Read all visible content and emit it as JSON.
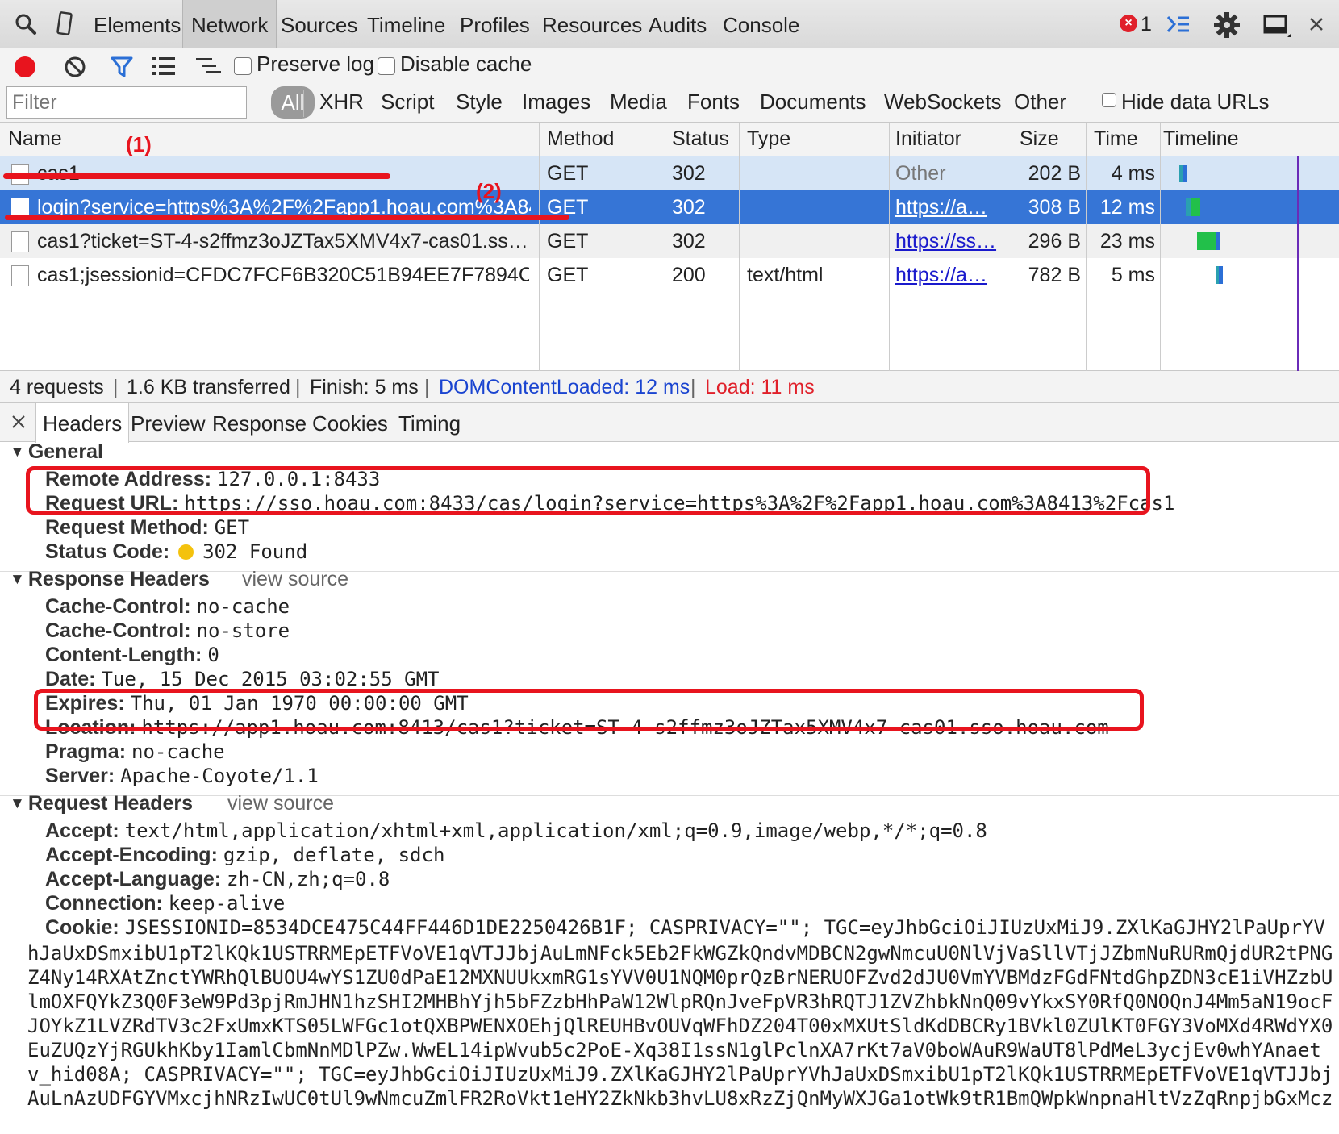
{
  "topbar": {
    "tabs": [
      "Elements",
      "Network",
      "Sources",
      "Timeline",
      "Profiles",
      "Resources",
      "Audits",
      "Console"
    ],
    "active_tab": "Network",
    "error_count": "1"
  },
  "toolbar": {
    "preserve_log": "Preserve log",
    "disable_cache": "Disable cache"
  },
  "filter": {
    "placeholder": "Filter",
    "types": [
      "All",
      "XHR",
      "Script",
      "Style",
      "Images",
      "Media",
      "Fonts",
      "Documents",
      "WebSockets",
      "Other"
    ],
    "hide_data_urls": "Hide data URLs"
  },
  "table": {
    "columns": [
      "Name",
      "Method",
      "Status",
      "Type",
      "Initiator",
      "Size",
      "Time",
      "Timeline"
    ],
    "rows": [
      {
        "name": "cas1",
        "method": "GET",
        "status": "302",
        "type": "",
        "initiator": "Other",
        "size": "202 B",
        "time": "4 ms"
      },
      {
        "name": "login?service=https%3A%2F%2Fapp1.hoau.com%3A84…",
        "method": "GET",
        "status": "302",
        "type": "",
        "initiator": "https://a…",
        "size": "308 B",
        "time": "12 ms"
      },
      {
        "name": "cas1?ticket=ST-4-s2ffmz3oJZTax5XMV4x7-cas01.ss…",
        "method": "GET",
        "status": "302",
        "type": "",
        "initiator": "https://ss…",
        "size": "296 B",
        "time": "23 ms"
      },
      {
        "name": "cas1;jsessionid=CFDC7FCF6B320C51B94EE7F7894C…",
        "method": "GET",
        "status": "200",
        "type": "text/html",
        "initiator": "https://a…",
        "size": "782 B",
        "time": "5 ms"
      }
    ]
  },
  "summary": {
    "requests": "4 requests",
    "transferred": "1.6 KB transferred",
    "finish": "Finish: 5 ms",
    "dcl": "DOMContentLoaded: 12 ms",
    "load": "Load: 11 ms"
  },
  "detail_tabs": [
    "Headers",
    "Preview",
    "Response",
    "Cookies",
    "Timing"
  ],
  "general": {
    "title": "General",
    "remote_address_k": "Remote Address:",
    "remote_address_v": "127.0.0.1:8433",
    "request_url_k": "Request URL:",
    "request_url_v": "https://sso.hoau.com:8433/cas/login?service=https%3A%2F%2Fapp1.hoau.com%3A8413%2Fcas1",
    "request_method_k": "Request Method:",
    "request_method_v": "GET",
    "status_code_k": "Status Code:",
    "status_code_v": "302 Found"
  },
  "response_headers": {
    "title": "Response Headers",
    "view_source": "view source",
    "items": [
      {
        "k": "Cache-Control:",
        "v": "no-cache"
      },
      {
        "k": "Cache-Control:",
        "v": "no-store"
      },
      {
        "k": "Content-Length:",
        "v": "0"
      },
      {
        "k": "Date:",
        "v": "Tue, 15 Dec 2015 03:02:55 GMT"
      },
      {
        "k": "Expires:",
        "v": "Thu, 01 Jan 1970 00:00:00 GMT"
      },
      {
        "k": "Location:",
        "v": "https://app1.hoau.com:8413/cas1?ticket=ST-4-s2ffmz3oJZTax5XMV4x7-cas01.sso.hoau.com"
      },
      {
        "k": "Pragma:",
        "v": "no-cache"
      },
      {
        "k": "Server:",
        "v": "Apache-Coyote/1.1"
      }
    ]
  },
  "request_headers": {
    "title": "Request Headers",
    "view_source": "view source",
    "items": [
      {
        "k": "Accept:",
        "v": "text/html,application/xhtml+xml,application/xml;q=0.9,image/webp,*/*;q=0.8"
      },
      {
        "k": "Accept-Encoding:",
        "v": "gzip, deflate, sdch"
      },
      {
        "k": "Accept-Language:",
        "v": "zh-CN,zh;q=0.8"
      },
      {
        "k": "Connection:",
        "v": "keep-alive"
      },
      {
        "k": "Cookie:",
        "v": "JSESSIONID=8534DCE475C44FF446D1DE2250426B1F; CASPRIVACY=\"\"; TGC=eyJhbGciOiJIUzUxMiJ9.ZXlKaGJHY2lPaUprYV"
      }
    ],
    "cookie_continuation": [
      "hJaUxDSmxibU1pT2lKQk1USTRRMEpETFVoVE1qVTJJbjAuLmNFck5Eb2FkWGZkQndvMDBCN2gwNmcuU0NlVjVaSllVTjJZbmNuRURmQjdUR2tPNG",
      "Z4Ny14RXAtZnctYWRhQlBUOU4wYS1ZU0dPaE12MXNUUkxmRG1sYVV0U1NQM0prQzBrNERUOFZvd2dJU0VmYVBMdzFGdFNtdGhpZDN3cE1iVHZzbU",
      "lmOXFQYkZ3Q0F3eW9Pd3pjRmJHN1hzSHI2MHBhYjh5bFZzbHhPaW12WlpRQnJveFpVR3hRQTJ1ZVZhbkNnQ09vYkxSY0RfQ0NOQnJ4Mm5aN19ocF",
      "JOYkZ1LVZRdTV3c2FxUmxKTS05LWFGc1otQXBPWENXOEhjQlREUHBvOUVqWFhDZ204T00xMXUtSldKdDBCRy1BVkl0ZUlKT0FGY3VoMXd4RWdYX0",
      "EuZUQzYjRGUkhKby1IamlCbmNnMDlPZw.WwEL14ipWvub5c2PoE-Xq38I1ssN1glPclnXA7rKt7aV0boWAuR9WaUT8lPdMeL3ycjEv0whYAnaet",
      "v_hid08A; CASPRIVACY=\"\"; TGC=eyJhbGciOiJIUzUxMiJ9.ZXlKaGJHY2lPaUprYVhJaUxDSmxibU1pT2lKQk1USTRRMEpETFVoVE1qVTJJbj",
      "AuLnAzUDFGYVMxcjhNRzIwUC0tUl9wNmcuZmlFR2RoVkt1eHY2ZkNkb3hvLU8xRzZjQnMyWXJGa1otWk9tR1BmQWpkWnpnaHltVzZqRnpjbGxMcz"
    ]
  },
  "annotations": {
    "mark1": "(1)",
    "mark2": "(2)"
  },
  "colors": {
    "accent": "#3675d6",
    "annotation": "#e8141e",
    "status_dot": "#f4c20d",
    "timeline_marker": "#6a2bb8"
  }
}
